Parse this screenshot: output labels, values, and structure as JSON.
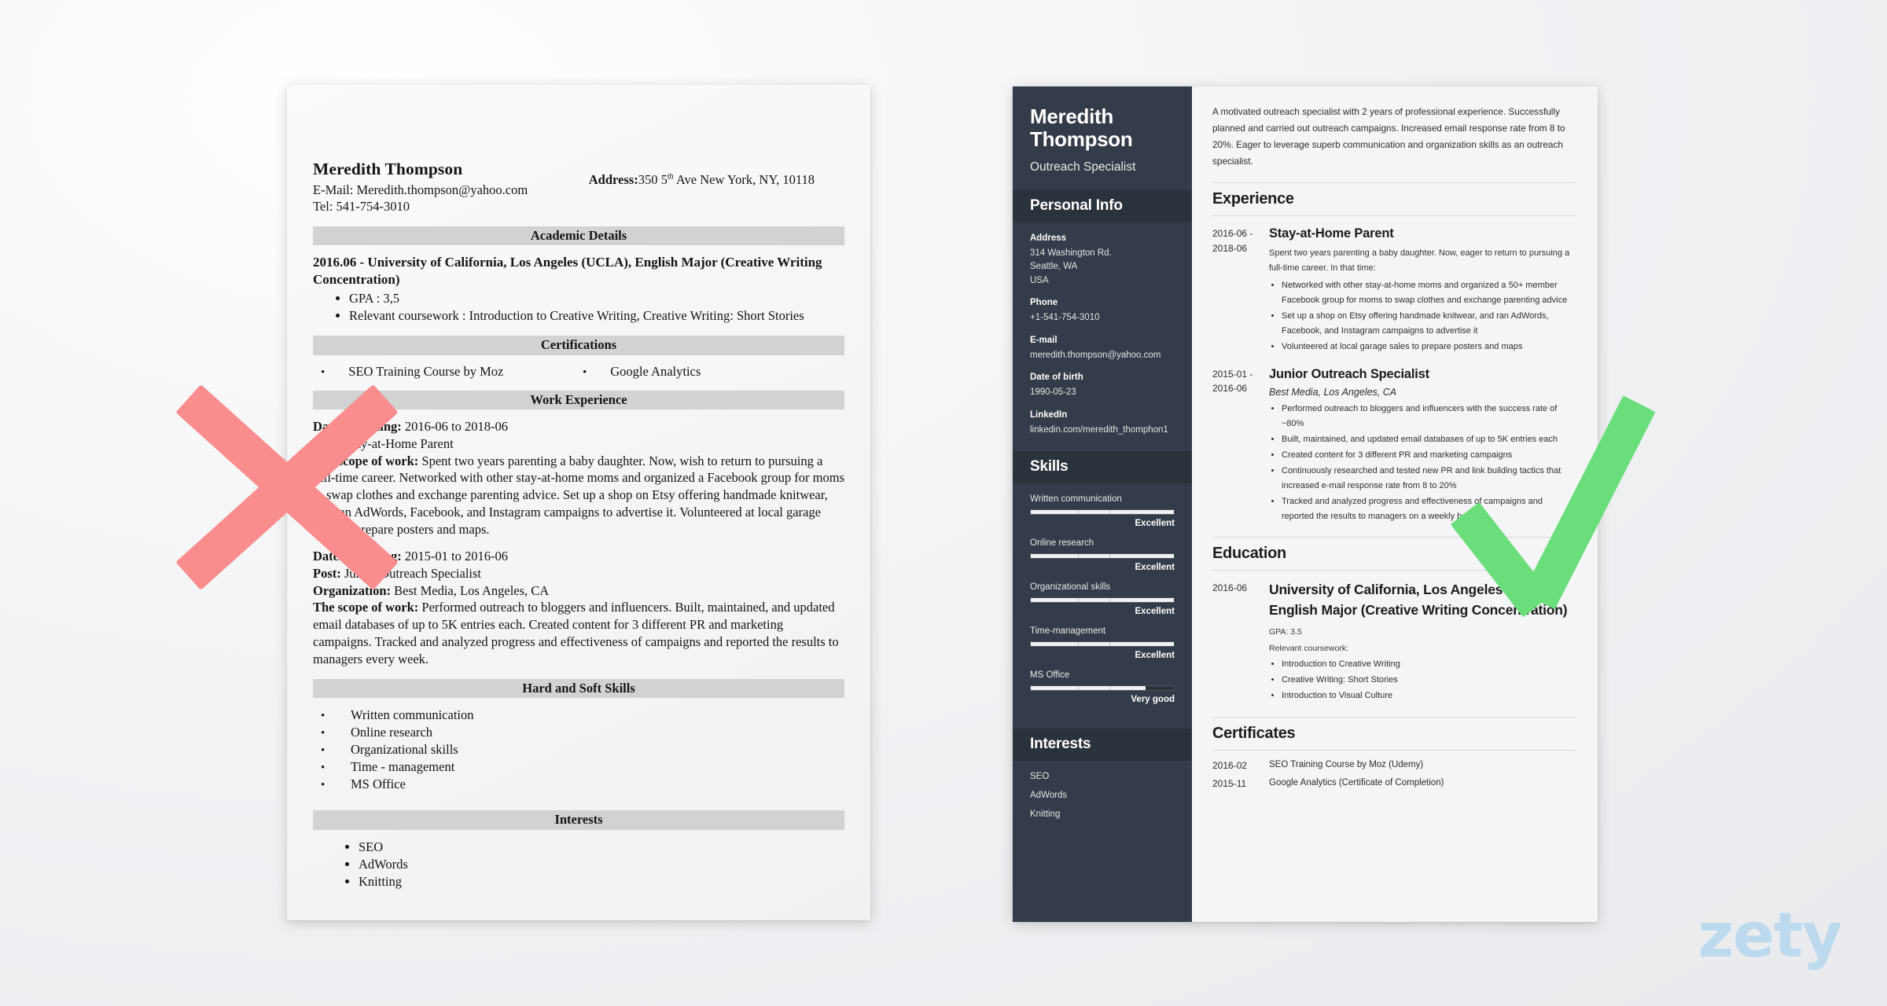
{
  "bad_resume": {
    "name": "Meredith Thompson",
    "email_line": "E-Mail: Meredith.thompson@yahoo.com",
    "tel_line": "Tel: 541-754-3010",
    "address_label": "Address:",
    "address_pre": "350 5",
    "address_sup": "th",
    "address_post": " Ave New York, NY, 10118",
    "sections": {
      "academic": "Academic Details",
      "certifications": "Certifications",
      "work": "Work Experience",
      "skills": "Hard and Soft Skills",
      "interests": "Interests"
    },
    "education_title": "2016.06 - University of California, Los Angeles (UCLA), English Major (Creative Writing Concentration)",
    "education_bullets": [
      "GPA : 3,5",
      "Relevant coursework : Introduction to Creative Writing, Creative Writing: Short Stories"
    ],
    "certifications": [
      "SEO Training Course by Moz",
      "Google Analytics"
    ],
    "jobs": [
      {
        "date_label": "Date of Joining:",
        "date_value": " 2016-06 to 2018-06",
        "post_label": "Post:",
        "post_value": " Stay-at-Home Parent",
        "scope_label": "The scope of work:",
        "scope_value": " Spent two years parenting a baby daughter. Now, wish to return to pursuing a full-time career. Networked with other stay-at-home moms and organized a Facebook group for moms to swap clothes and exchange parenting advice. Set up a shop on Etsy offering handmade knitwear, and ran AdWords, Facebook, and Instagram campaigns to advertise it. Volunteered at local garage sales to prepare posters and maps."
      },
      {
        "date_label": "Date of Joining:",
        "date_value": " 2015-01 to 2016-06",
        "post_label": "Post:",
        "post_value": " Junior Outreach Specialist",
        "org_label": "Organization:",
        "org_value": " Best Media, Los Angeles, CA",
        "scope_label": "The scope of work:",
        "scope_value": " Performed outreach to bloggers and influencers. Built, maintained, and updated email databases of up to 5K entries each. Created content for 3 different PR and marketing campaigns. Tracked and analyzed progress and effectiveness of campaigns and reported the results to managers every week."
      }
    ],
    "skills": [
      "Written communication",
      "Online research",
      "Organizational skills",
      "Time - management",
      "MS Office"
    ],
    "interests": [
      "SEO",
      "AdWords",
      "Knitting"
    ]
  },
  "good_resume": {
    "name_line1": "Meredith",
    "name_line2": "Thompson",
    "role": "Outreach Specialist",
    "sidebar": {
      "personal_info_title": "Personal Info",
      "fields": [
        {
          "label": "Address",
          "value": "314 Washington Rd.\nSeattle, WA\nUSA"
        },
        {
          "label": "Phone",
          "value": "+1-541-754-3010"
        },
        {
          "label": "E-mail",
          "value": "meredith.thompson@yahoo.com"
        },
        {
          "label": "Date of birth",
          "value": "1990-05-23"
        },
        {
          "label": "LinkedIn",
          "value": "linkedin.com/meredith_thomphon1"
        }
      ],
      "skills_title": "Skills",
      "skills": [
        {
          "name": "Written communication",
          "rating": "Excellent",
          "pct": 100
        },
        {
          "name": "Online research",
          "rating": "Excellent",
          "pct": 100
        },
        {
          "name": "Organizational skills",
          "rating": "Excellent",
          "pct": 100
        },
        {
          "name": "Time-management",
          "rating": "Excellent",
          "pct": 100
        },
        {
          "name": "MS Office",
          "rating": "Very good",
          "pct": 80
        }
      ],
      "interests_title": "Interests",
      "interests": [
        "SEO",
        "AdWords",
        "Knitting"
      ]
    },
    "summary": "A motivated outreach specialist with 2 years of professional experience. Successfully planned and carried out outreach campaigns. Increased email response rate from 8 to 20%. Eager to leverage superb communication and organization skills as an outreach specialist.",
    "experience_title": "Experience",
    "experience": [
      {
        "date_from": "2016-06 -",
        "date_to": "2018-06",
        "title": "Stay-at-Home Parent",
        "company": "",
        "desc": "Spent two years parenting a baby daughter. Now, eager to return to pursuing a full-time career. In that time:",
        "bullets": [
          "Networked with other stay-at-home moms and organized a 50+ member Facebook group for moms to swap clothes and exchange parenting advice",
          "Set up a shop on Etsy offering handmade knitwear, and ran AdWords, Facebook, and Instagram campaigns to advertise it",
          "Volunteered at local garage sales to prepare posters and maps"
        ]
      },
      {
        "date_from": "2015-01 -",
        "date_to": "2016-06",
        "title": "Junior Outreach Specialist",
        "company": "Best Media, Los Angeles, CA",
        "desc": "",
        "bullets": [
          "Performed outreach to bloggers and influencers with the success rate of ~80%",
          "Built, maintained, and updated email databases of up to 5K entries each",
          "Created content for 3 different PR and marketing campaigns",
          "Continuously researched and tested new PR and link building tactics that increased e-mail response rate from 8 to 20%",
          "Tracked and analyzed progress and effectiveness of campaigns and reported the results to managers on a weekly basis"
        ]
      }
    ],
    "education_title": "Education",
    "education": {
      "date": "2016-06",
      "title": "University of California, Los Angeles (UCLA), English Major (Creative Writing Concentration)",
      "gpa": "GPA: 3.5",
      "coursework_label": "Relevant coursework:",
      "coursework": [
        "Introduction to Creative Writing",
        "Creative Writing: Short Stories",
        "Introduction to Visual Culture"
      ]
    },
    "certificates_title": "Certificates",
    "certificates": [
      {
        "date": "2016-02",
        "name": "SEO Training Course by Moz (Udemy)"
      },
      {
        "date": "2015-11",
        "name": "Google Analytics (Certificate of Completion)"
      }
    ]
  },
  "branding": {
    "logo_text": "zety"
  },
  "colors": {
    "bad_mark": "#f98d8d",
    "good_mark": "#6ade7a",
    "sidebar_bg": "#333c48",
    "sidebar_header_bg": "#2a323c",
    "logo": "#bcd9ee"
  }
}
